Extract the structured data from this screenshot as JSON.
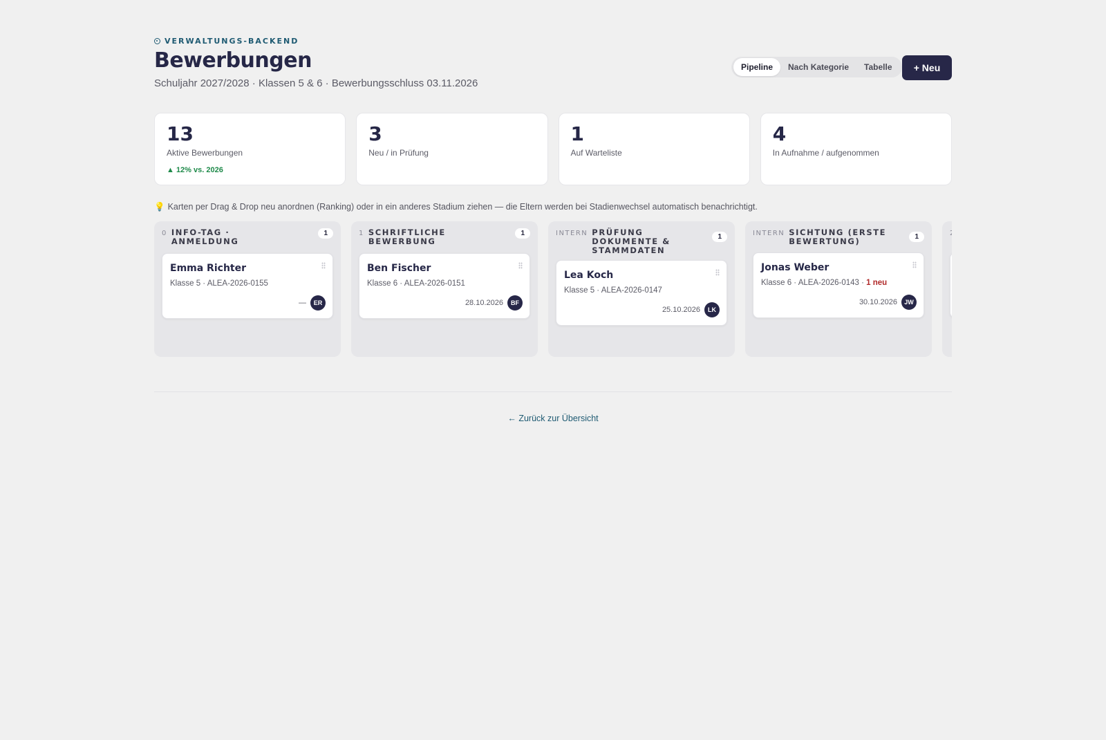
{
  "header": {
    "eyebrow": "VERWALTUNGS-BACKEND",
    "title": "Bewerbungen",
    "subtitle": "Schuljahr 2027/2028 · Klassen 5 & 6 · Bewerbungsschluss 03.11.2026"
  },
  "view_switch": {
    "options": [
      "Pipeline",
      "Nach Kategorie",
      "Tabelle"
    ],
    "selected": "Pipeline"
  },
  "new_button": "+ Neu",
  "stats": [
    {
      "value": "13",
      "label": "Aktive Bewerbungen",
      "trend": "▲ 12% vs. 2026"
    },
    {
      "value": "3",
      "label": "Neu / in Prüfung"
    },
    {
      "value": "1",
      "label": "Auf Warteliste"
    },
    {
      "value": "4",
      "label": "In Aufnahme / aufgenommen"
    }
  ],
  "hint": "Karten per Drag & Drop neu anordnen (Ranking) oder in ein anderes Stadium ziehen — die Eltern werden bei Stadienwechsel automatisch benachrichtigt.",
  "columns": [
    {
      "prefix": "0",
      "title": "INFO-TAG · ANMELDUNG",
      "count": "1",
      "cards": [
        {
          "name": "Emma Richter",
          "meta": "Klasse 5 · ALEA-2026-0155",
          "flag": "",
          "date": "—",
          "initials": "ER"
        }
      ]
    },
    {
      "prefix": "1",
      "title": "SCHRIFTLICHE BEWERBUNG",
      "count": "1",
      "cards": [
        {
          "name": "Ben Fischer",
          "meta": "Klasse 6 · ALEA-2026-0151",
          "flag": "",
          "date": "28.10.2026",
          "initials": "BF"
        }
      ]
    },
    {
      "prefix": "INTERN",
      "title": "PRÜFUNG DOKUMENTE & STAMMDATEN",
      "count": "1",
      "cards": [
        {
          "name": "Lea Koch",
          "meta": "Klasse 5 · ALEA-2026-0147",
          "flag": "",
          "date": "25.10.2026",
          "initials": "LK"
        }
      ]
    },
    {
      "prefix": "INTERN",
      "title": "SICHTUNG (ERSTE BEWERTUNG)",
      "count": "1",
      "cards": [
        {
          "name": "Jonas Weber",
          "meta": "Klasse 6 · ALEA-2026-0143 · ",
          "flag": "1 neu",
          "date": "30.10.2026",
          "initials": "JW"
        }
      ]
    },
    {
      "prefix": "2",
      "title": "",
      "count": "",
      "cards": []
    }
  ],
  "back_link": "← Zurück zur Übersicht",
  "colors": {
    "brand": "#272748",
    "accent": "#1e5a72",
    "trend_up": "#1f8a4a",
    "new_flag": "#b02a2a"
  }
}
